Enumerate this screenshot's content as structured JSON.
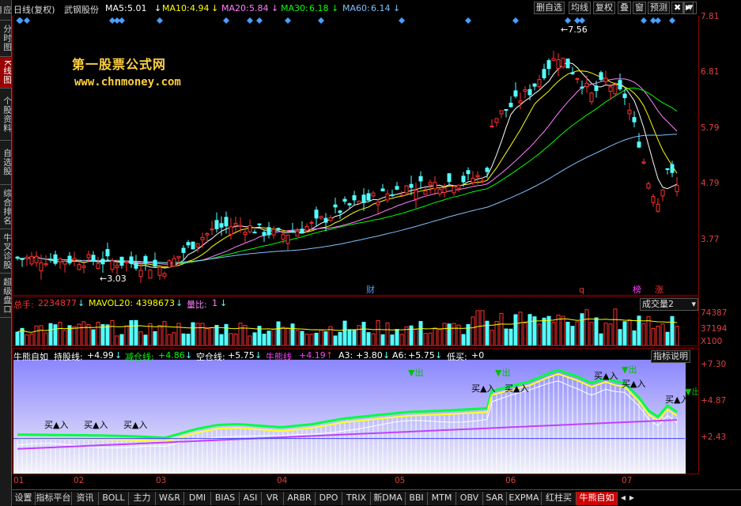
{
  "sidebar": {
    "items": [
      {
        "label": "应用"
      },
      {
        "label": "分时图"
      },
      {
        "label": "K线图",
        "active": true
      },
      {
        "label": "个股资料"
      },
      {
        "label": "自选股"
      },
      {
        "label": "综合排名"
      },
      {
        "label": "牛叉诊股"
      },
      {
        "label": "超级盘口"
      }
    ]
  },
  "header": {
    "period": "日线(复权)",
    "stock_name": "武钢股份",
    "ma5": {
      "label": "MA5:",
      "value": "5.01"
    },
    "ma10": {
      "label": "MA10:",
      "value": "4.94"
    },
    "ma20": {
      "label": "MA20:",
      "value": "5.84"
    },
    "ma30": {
      "label": "MA30:",
      "value": "6.18"
    },
    "ma60": {
      "label": "MA60:",
      "value": "6.14"
    },
    "buttons": {
      "delete": "删自选",
      "avg": "均线",
      "rights": "复权",
      "overlay": "叠",
      "window": "窗",
      "forecast": "预测"
    }
  },
  "watermark": {
    "line1": "第一股票公式网",
    "line2": "www.chnmoney.com"
  },
  "price_axis": {
    "ticks": [
      "7.81",
      "6.81",
      "5.79",
      "4.79",
      "3.77"
    ]
  },
  "annotations": {
    "high": "7.56",
    "low": "3.03"
  },
  "event_markers": {
    "cai": "财",
    "q": "q",
    "bang": "榜",
    "zhang": "涨"
  },
  "volume": {
    "total_label": "总手:",
    "total_value": "2234877",
    "mavol_label": "MAVOL20:",
    "mavol_value": "4398673",
    "ratio_label": "量比:",
    "ratio_value": "1",
    "selector": "成交量2",
    "axis": [
      "74387",
      "37194",
      "X100"
    ]
  },
  "indicator": {
    "name": "牛熊自如",
    "hold_label": "持股线:",
    "hold_value": "+4.99",
    "reduce_label": "减仓线:",
    "reduce_value": "+4.86",
    "empty_label": "空仓线:",
    "empty_value": "+5.75",
    "bear_label": "牛熊线",
    "bear_value": "+4.19",
    "a3_label": "A3:",
    "a3_value": "+3.80",
    "a6_label": "A6:",
    "a6_value": "+5.75",
    "low_buy_label": "低买:",
    "low_buy_value": "+0",
    "explain_button": "指标说明",
    "axis": [
      "+7.30",
      "+4.87",
      "+2.43"
    ],
    "buy_label": "买▲入",
    "sell_label": "▼出"
  },
  "x_axis": {
    "months": [
      "01",
      "02",
      "03",
      "04",
      "05",
      "06",
      "07"
    ]
  },
  "tabs": [
    "设置",
    "指标平台",
    "资讯",
    "BOLL",
    "主力",
    "W&R",
    "DMI",
    "BIAS",
    "ASI",
    "VR",
    "ARBR",
    "DPO",
    "TRIX",
    "新DMA",
    "BBI",
    "MTM",
    "OBV",
    "SAR",
    "EXPMA",
    "红柱买",
    "牛熊自如"
  ],
  "colors": {
    "axis": "#e04040",
    "ma5": "#ffffff",
    "ma10": "#ffff00",
    "ma20": "#ff80ff",
    "ma30": "#00ff00",
    "ma60": "#80c0ff",
    "up": "#ff3030",
    "down": "#54ffff",
    "watermark": "#ffd040"
  }
}
